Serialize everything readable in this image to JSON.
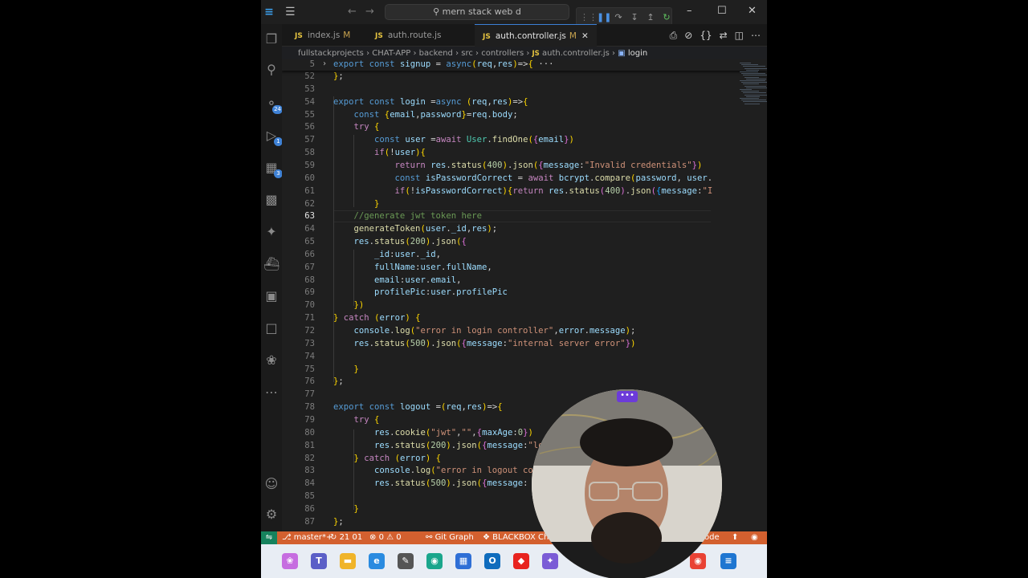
{
  "titlebar": {
    "search_text": "mern stack web d",
    "debug_controls": [
      "drag-handle",
      "pause",
      "step-over",
      "step-into",
      "step-out",
      "restart"
    ]
  },
  "activity_bar": {
    "items": [
      {
        "name": "explorer",
        "badge": ""
      },
      {
        "name": "search",
        "badge": ""
      },
      {
        "name": "source-control",
        "badge": "24"
      },
      {
        "name": "run-debug",
        "badge": "1"
      },
      {
        "name": "extensions",
        "badge": "3"
      },
      {
        "name": "remote-explorer",
        "badge": ""
      },
      {
        "name": "python",
        "badge": ""
      },
      {
        "name": "docker",
        "badge": ""
      },
      {
        "name": "tabs",
        "badge": ""
      },
      {
        "name": "chat",
        "badge": ""
      },
      {
        "name": "mongodb",
        "badge": ""
      },
      {
        "name": "more",
        "badge": ""
      }
    ],
    "bottom": [
      "accounts",
      "manage"
    ]
  },
  "tabs": [
    {
      "label": "index.js",
      "modified": "M",
      "active": false
    },
    {
      "label": "auth.route.js",
      "modified": "",
      "active": false
    },
    {
      "label": "auth.controller.js",
      "modified": "M",
      "active": true
    }
  ],
  "tab_prefix": "JS",
  "breadcrumb": [
    "fullstackprojects",
    "CHAT-APP",
    "backend",
    "src",
    "controllers",
    "auth.controller.js",
    "login"
  ],
  "editor": {
    "sticky_line_no": "5",
    "sticky_code": "export const signup = async(req,res)=>{ ···",
    "current_line": 63,
    "lines": [
      {
        "no": "52",
        "code": "};"
      },
      {
        "no": "53",
        "code": ""
      },
      {
        "no": "54",
        "code": "export const login =async (req,res)=>{"
      },
      {
        "no": "55",
        "code": "    const {email,password}=req.body;"
      },
      {
        "no": "56",
        "code": "    try {"
      },
      {
        "no": "57",
        "code": "        const user =await User.findOne({email})"
      },
      {
        "no": "58",
        "code": "        if(!user){"
      },
      {
        "no": "59",
        "code": "            return res.status(400).json({message:\"Invalid credentials\"})"
      },
      {
        "no": "60",
        "code": "            const isPasswordCorrect = await bcrypt.compare(password, user."
      },
      {
        "no": "61",
        "code": "            if(!isPasswordCorrect){return res.status(400).json({message:\"I"
      },
      {
        "no": "62",
        "code": "        }"
      },
      {
        "no": "63",
        "code": "    //generate jwt token here"
      },
      {
        "no": "64",
        "code": "    generateToken(user._id,res);"
      },
      {
        "no": "65",
        "code": "    res.status(200).json({"
      },
      {
        "no": "66",
        "code": "        _id:user._id,"
      },
      {
        "no": "67",
        "code": "        fullName:user.fullName,"
      },
      {
        "no": "68",
        "code": "        email:user.email,"
      },
      {
        "no": "69",
        "code": "        profilePic:user.profilePic"
      },
      {
        "no": "70",
        "code": "    })"
      },
      {
        "no": "71",
        "code": "} catch (error) {"
      },
      {
        "no": "72",
        "code": "    console.log(\"error in login controller\",error.message);"
      },
      {
        "no": "73",
        "code": "    res.status(500).json({message:\"internal server error\"})"
      },
      {
        "no": "74",
        "code": ""
      },
      {
        "no": "75",
        "code": "    }"
      },
      {
        "no": "76",
        "code": "};"
      },
      {
        "no": "77",
        "code": ""
      },
      {
        "no": "78",
        "code": "export const logout =(req,res)=>{"
      },
      {
        "no": "79",
        "code": "    try {"
      },
      {
        "no": "80",
        "code": "        res.cookie(\"jwt\",\"\",{maxAge:0})"
      },
      {
        "no": "81",
        "code": "        res.status(200).json({message:\"lo"
      },
      {
        "no": "82",
        "code": "    } catch (error) {"
      },
      {
        "no": "83",
        "code": "        console.log(\"error in logout co"
      },
      {
        "no": "84",
        "code": "        res.status(500).json({message:"
      },
      {
        "no": "85",
        "code": ""
      },
      {
        "no": "86",
        "code": "    }"
      },
      {
        "no": "87",
        "code": "};"
      }
    ]
  },
  "statusbar": {
    "branch": "master*+",
    "sync": "21 01",
    "problems": "0",
    "warnings": "0",
    "git_graph": "Git Graph",
    "blackbox": "BLACKBOX Chat",
    "right_label": "ode"
  },
  "webcam": {
    "more_label": "•••"
  },
  "colors": {
    "accent": "#3b7fd6",
    "statusbar": "#d3602f",
    "remote": "#16825d"
  }
}
